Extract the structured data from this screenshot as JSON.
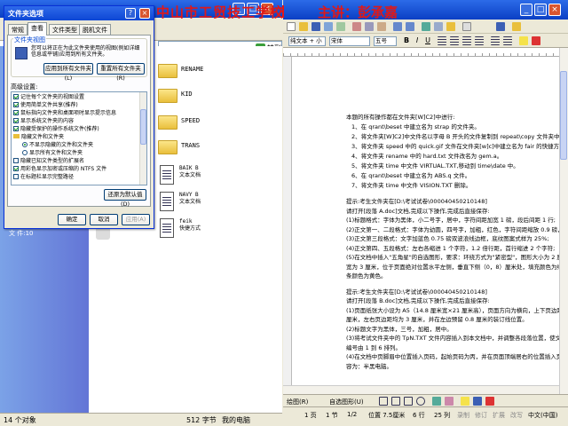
{
  "overlay": {
    "school": "中山市工贸技工学校",
    "speaker": "主讲：彭承嘉"
  },
  "explorer": {
    "go_label": "转到",
    "folders": [
      {
        "name": "RENAME"
      },
      {
        "name": "KID"
      },
      {
        "name": "SPEED"
      },
      {
        "name": "TRANS"
      }
    ],
    "files": [
      {
        "name": "BAIK B",
        "sub": "文本文档"
      },
      {
        "name": "NAVY B",
        "sub": "文本文档"
      },
      {
        "name": "feik",
        "sub": "快捷方式"
      }
    ],
    "left_pane_text": "文  件:10",
    "status": {
      "objects": "14 个对象",
      "size": "512 字节",
      "location": "我的电脑"
    }
  },
  "dialog": {
    "title": "文件夹选项",
    "help_btn": "?",
    "close_btn": "×",
    "tabs": [
      "常规",
      "查看",
      "文件类型",
      "脱机文件"
    ],
    "active_tab": 1,
    "group_title": "文件夹视图",
    "group_desc": "您可以将正在为此文件夹使用的视图(例如详细信息或平铺)应用到所有文件夹。",
    "apply_all_btn": "应用到所有文件夹(L)",
    "reset_all_btn": "重置所有文件夹(R)",
    "advanced_title": "高级设置:",
    "tree": [
      {
        "type": "check",
        "on": true,
        "text": "记住每个文件夹的视图设置"
      },
      {
        "type": "check",
        "on": true,
        "text": "使用简单文件共享(推荐)"
      },
      {
        "type": "check",
        "on": true,
        "text": "鼠标指向文件夹和桌面项时显示提示信息"
      },
      {
        "type": "check",
        "on": true,
        "text": "显示系统文件夹的内容"
      },
      {
        "type": "check",
        "on": true,
        "text": "隐藏受保护的操作系统文件(推荐)"
      },
      {
        "type": "folder",
        "text": "隐藏文件和文件夹"
      },
      {
        "type": "radio",
        "on": true,
        "text": "不显示隐藏的文件和文件夹",
        "indent": true
      },
      {
        "type": "radio",
        "on": false,
        "text": "显示所有文件和文件夹",
        "indent": true
      },
      {
        "type": "check",
        "on": false,
        "text": "隐藏已知文件类型的扩展名"
      },
      {
        "type": "check",
        "on": true,
        "text": "用彩色显示加密或压缩的 NTFS 文件"
      },
      {
        "type": "check",
        "on": false,
        "text": "在标题栏显示完整路径"
      }
    ],
    "restore_btn": "还原为默认值(D)",
    "ok_btn": "确定",
    "cancel_btn": "取消",
    "apply_btn": "应用(A)"
  },
  "word": {
    "toolbar": {
      "style_value": "纯文本 + 小",
      "font_value": "宋体",
      "size_value": "五号"
    },
    "doc_lines": [
      {
        "text": "本题的所有操作都在文件夹[W]C2]中进行:",
        "indent": false
      },
      {
        "text": "1、在 qrant\\beset 中建立名为 strap 的文件夹。",
        "indent": true
      },
      {
        "text": "2、将文件夹[W]C2]中文件名以字母 B 开头的文件复制到 repeat\\copy 文件夹中。",
        "indent": true
      },
      {
        "text": "3、将文件夹 speed 中的 quick.gif 文件在文件夹[w]c]中建立名为 fair 的快捷方式。",
        "indent": true
      },
      {
        "text": "4、将文件夹 rename 中的 hard.txt 文件改名为 gem.a。",
        "indent": true
      },
      {
        "text": "5、将文件夹 time 中文件 VIRTUAL.TXT,移动到 time\\date 中。",
        "indent": true
      },
      {
        "text": "6、在 qrant\\beset 中建立名为 ABS.q 文件。",
        "indent": true
      },
      {
        "text": "7、将文件夹 time 中文件 VISION.TXT 删除。",
        "indent": true
      },
      {
        "text": "",
        "indent": false
      },
      {
        "text": "提示:考生文件夹在[D:\\考试试卷\\000040450210148]",
        "indent": false
      },
      {
        "text": "请打开[段落 A.doc]文档,完成以下操作,完成后直接保存:",
        "indent": false
      },
      {
        "text": "(1)标题格式：字体为黑体，小二号字，居中，字符间距加宽 1 磅，段后间距 1 行;",
        "indent": false
      },
      {
        "text": "(2)正文第一、二段格式：字体为幼圆，四号字，加粗，红色，字符间距缩放 0.9 磅，缩放",
        "indent": false
      },
      {
        "text": "(3)正文第三段格式：文字加蓝色 0.75 磅双波浪线边框，底纹图案式样为 25%;",
        "indent": false
      },
      {
        "text": "(4)正文第四、五段格式：左右各缩进 1 个字符，1.2 倍行距，首行缩进 2 个字符;",
        "indent": false
      },
      {
        "text": "(5)在文档中插入\"五角星\"的自选图形，要求：环绕方式为\"紧密型\"，图形大小为 2 厘",
        "indent": false
      },
      {
        "text": "宽为 3 厘米，位于页面绝对位置水平左侧，垂直下侧（0，8）厘米处，填充颜色为绿色",
        "indent": false
      },
      {
        "text": "条颜色为黄色。",
        "indent": false
      },
      {
        "text": "",
        "indent": false
      },
      {
        "text": "提示:考生文件夹在[D:\\考试试卷\\000040450210148]",
        "indent": false
      },
      {
        "text": "请打开[段落 B.doc]文档,完成以下操作,完成后直接保存:",
        "indent": false
      },
      {
        "text": "(1)页面纸张大小设为 A5（14.8 厘米宽×21 厘米高），页面方向为横向，上下页边距均为",
        "indent": false
      },
      {
        "text": "厘米，左右页边距均为 3 厘米，并在左边预留 0.8 厘米的装订线位置。",
        "indent": false
      },
      {
        "text": "(2)标题文字为黑体，三号，加粗，居中。",
        "indent": false
      },
      {
        "text": "(3)将考试文件夹中的 TpN.TXT 文件内容插入到本文档中，并调整各段落位置，使文档的",
        "indent": false
      },
      {
        "text": "编号由 1 到 6 排列。",
        "indent": false
      },
      {
        "text": "(4)在文档中页脚眉中位置插入页码，起始页码为丙，并在页面顶端居右的位置插入页眉，",
        "indent": false
      },
      {
        "text": "容为：半黑电脑。",
        "indent": false
      }
    ],
    "drawbar": {
      "draw_label": "绘图(R)",
      "autoshape_label": "自选图形(U)"
    },
    "status": {
      "page": "1 页",
      "section": "1 节",
      "pages": "1/2",
      "pos": "位置 7.5厘米",
      "line": "6 行",
      "col": "25 列",
      "rec": "录制",
      "rev": "修订",
      "ext": "扩展",
      "ovr": "改写",
      "lang": "中文(中国)"
    }
  },
  "colors": {
    "xp_blue": "#0A3FC4",
    "overlay_red": "#E01818"
  }
}
